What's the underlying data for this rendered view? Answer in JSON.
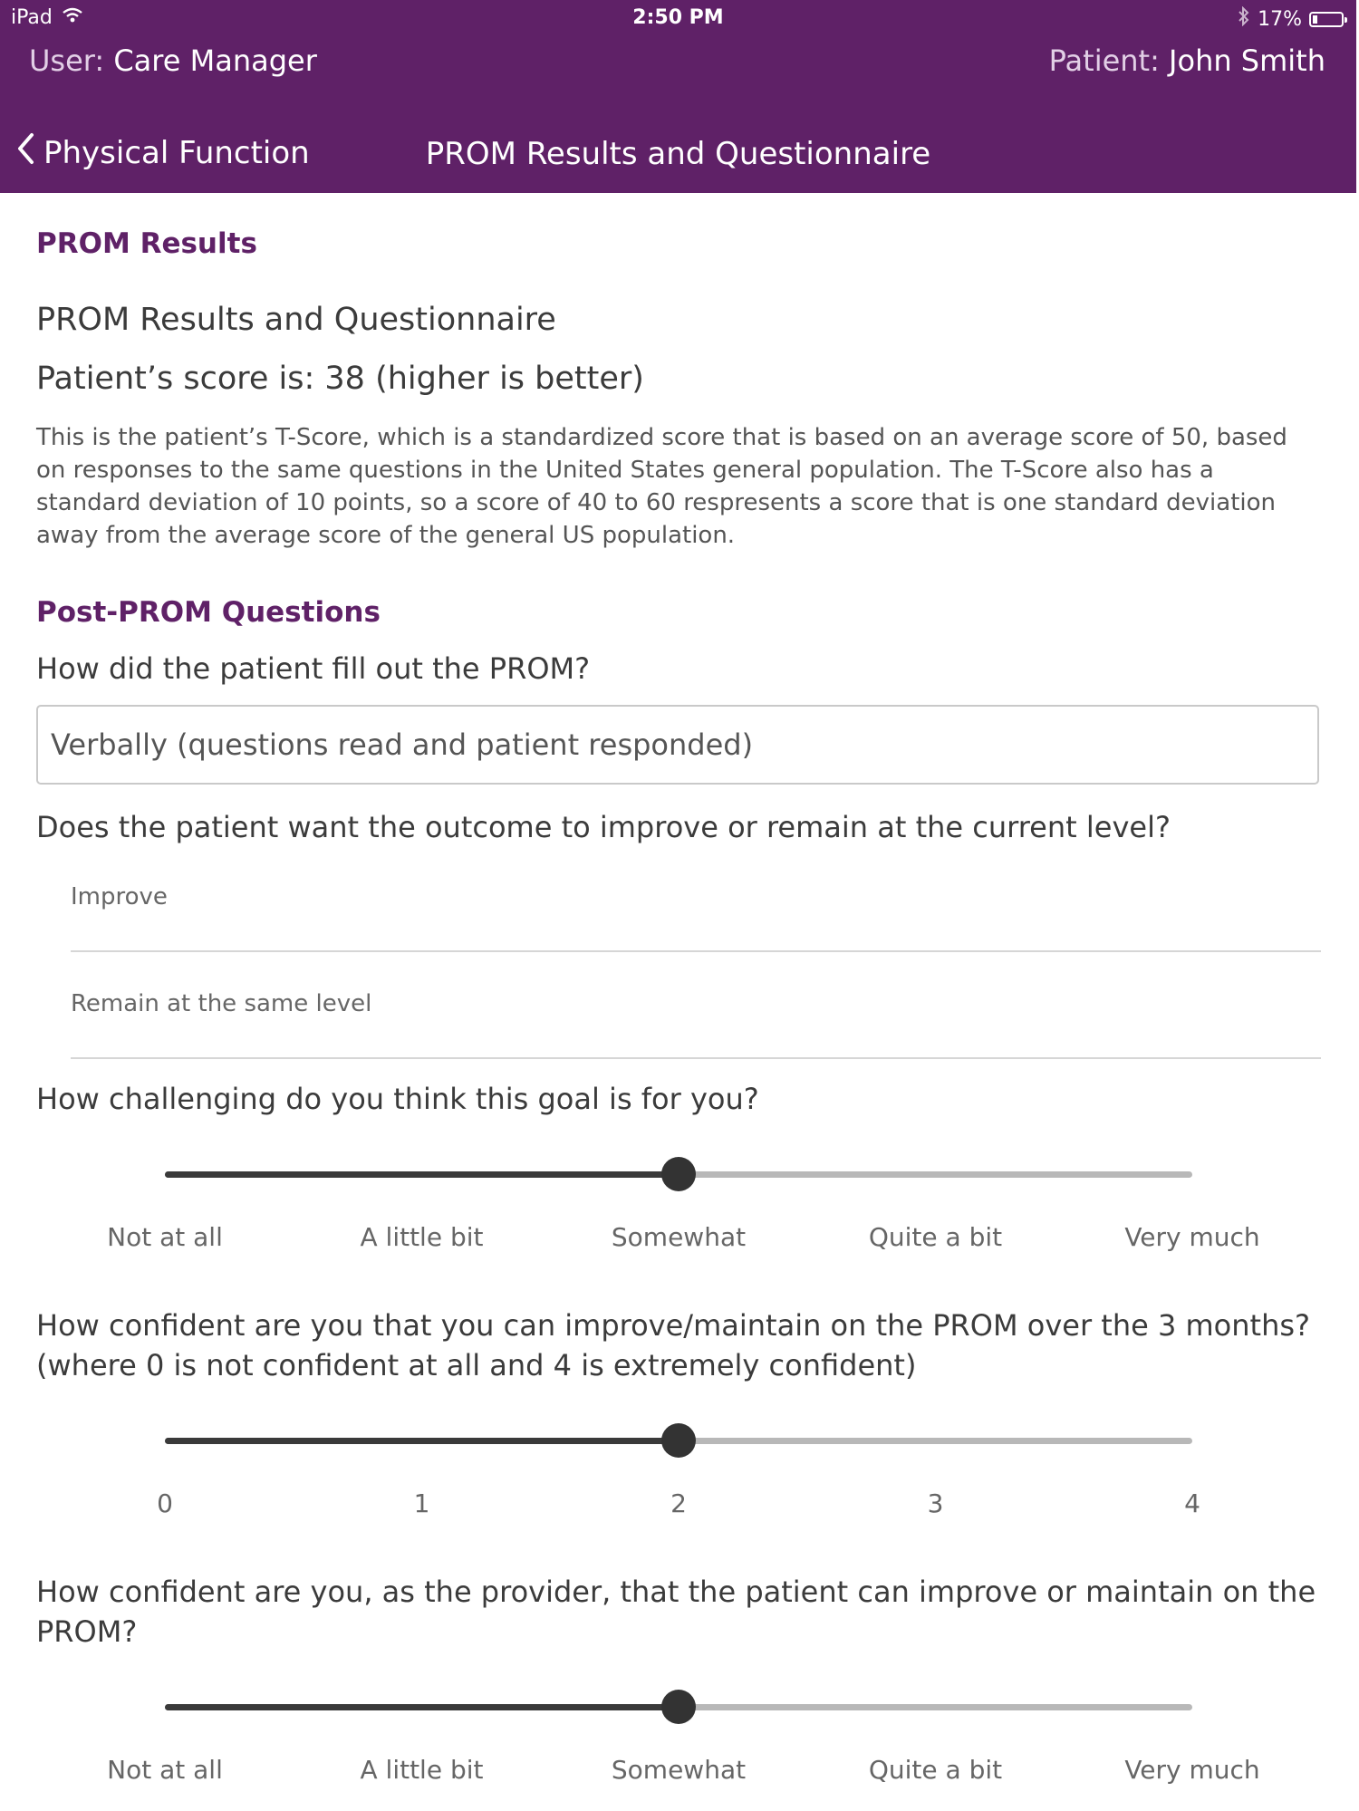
{
  "status_bar": {
    "device": "iPad",
    "time": "2:50 PM",
    "battery": "17%",
    "battery_level": 0.17
  },
  "header": {
    "user_label": "User:",
    "user_value": "Care Manager",
    "patient_label": "Patient:",
    "patient_value": "John Smith",
    "back_label": "Physical Function",
    "title": "PROM Results and Questionnaire"
  },
  "results": {
    "heading": "PROM Results",
    "subtitle": "PROM Results and Questionnaire",
    "score_text": "Patient’s score is: 38 (higher is better)",
    "description": "This is the patient’s T-Score, which is a standardized score that is based on an average score of 50, based on responses to the same questions in the United States general population. The T-Score also has a standard deviation of 10 points, so a score of 40 to 60 respresents a score that is one standard deviation away from the average score of the general US population."
  },
  "post": {
    "heading": "Post-PROM Questions",
    "q1": "How did the patient fill out the PROM?",
    "q1_value": "Verbally (questions read and patient responded)",
    "q2": "Does the patient want the outcome to improve or remain at the current level?",
    "q2_options": [
      "Improve",
      "Remain at the same level"
    ],
    "q3": "How challenging do you think this goal is for you?",
    "q3_labels": [
      "Not at all",
      "A little bit",
      "Somewhat",
      "Quite a bit",
      "Very much"
    ],
    "q3_value": 2,
    "q4": "How confident are you that you can improve/maintain on the PROM over the 3 months? (where 0 is not confident at all and 4 is extremely confident)",
    "q4_labels": [
      "0",
      "1",
      "2",
      "3",
      "4"
    ],
    "q4_value": 2,
    "q5": "How confident are you, as the provider, that the patient can improve or maintain on the PROM?",
    "q5_labels": [
      "Not at all",
      "A little bit",
      "Somewhat",
      "Quite a bit",
      "Very much"
    ],
    "q5_value": 2
  }
}
